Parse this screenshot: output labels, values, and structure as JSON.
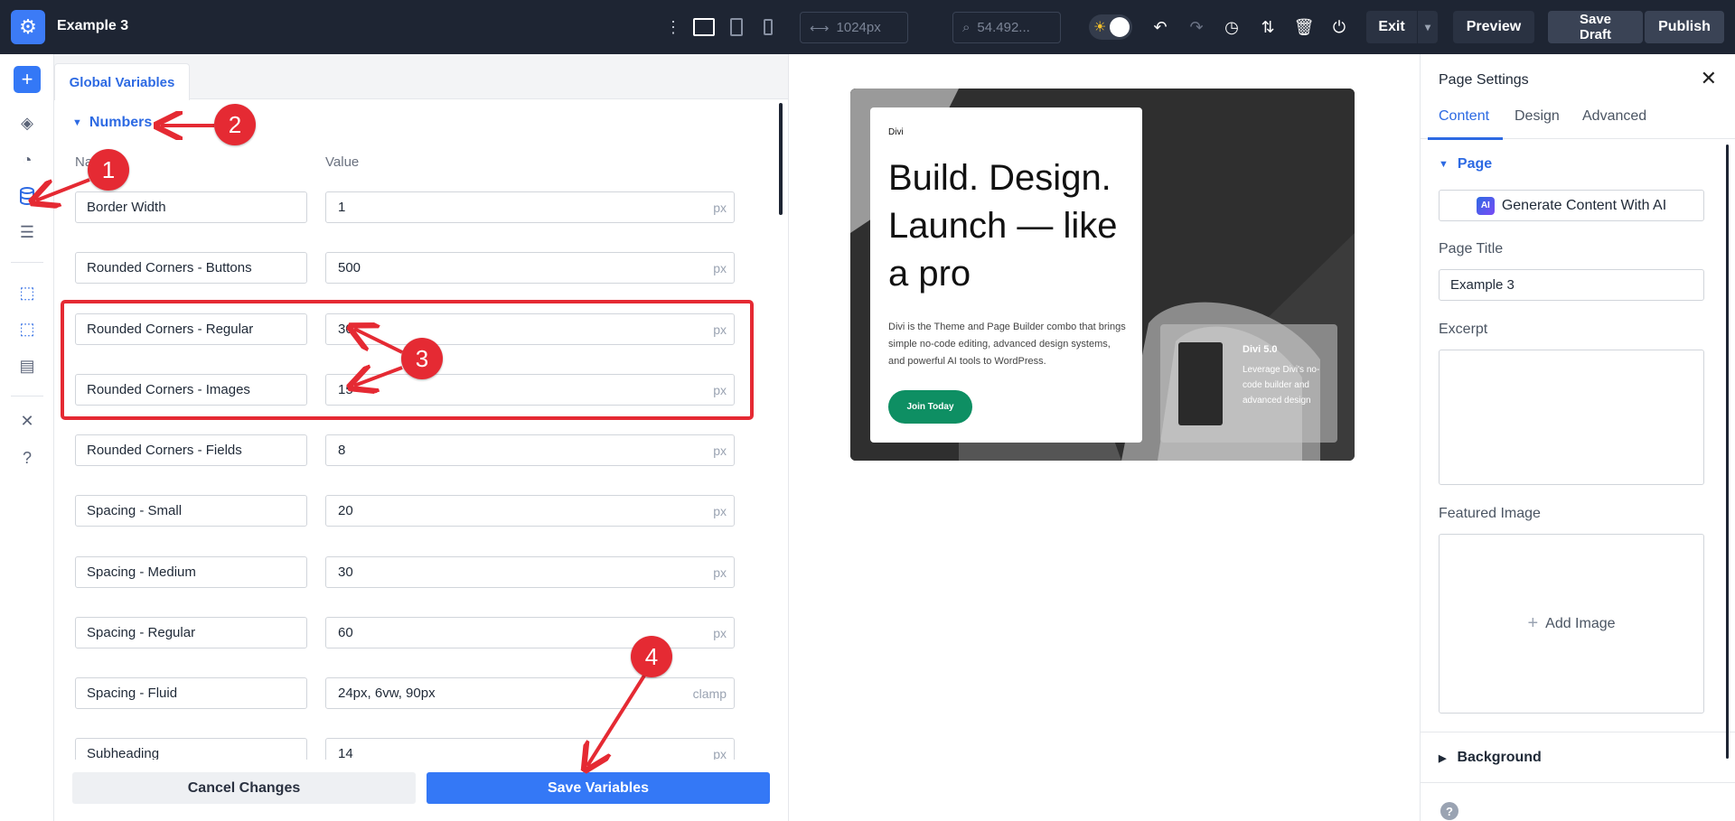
{
  "topbar": {
    "doc_title": "Example 3",
    "width_value": "1024px",
    "zoom_value": "54.492...",
    "exit_label": "Exit",
    "preview_label": "Preview",
    "save_draft_label": "Save\nDraft",
    "publish_label": "Publish"
  },
  "variables_panel": {
    "tab_label": "Global Variables",
    "section_label": "Numbers",
    "col_name": "Name",
    "col_value": "Value",
    "rows": [
      {
        "name": "Border Width",
        "value": "1",
        "unit": "px"
      },
      {
        "name": "Rounded Corners - Buttons",
        "value": "500",
        "unit": "px"
      },
      {
        "name": "Rounded Corners - Regular",
        "value": "30",
        "unit": "px"
      },
      {
        "name": "Rounded Corners - Images",
        "value": "15",
        "unit": "px"
      },
      {
        "name": "Rounded Corners - Fields",
        "value": "8",
        "unit": "px"
      },
      {
        "name": "Spacing - Small",
        "value": "20",
        "unit": "px"
      },
      {
        "name": "Spacing - Medium",
        "value": "30",
        "unit": "px"
      },
      {
        "name": "Spacing - Regular",
        "value": "60",
        "unit": "px"
      },
      {
        "name": "Spacing - Fluid",
        "value": "24px, 6vw, 90px",
        "unit": "clamp"
      },
      {
        "name": "Subheading",
        "value": "14",
        "unit": "px"
      }
    ],
    "cancel_label": "Cancel Changes",
    "save_label": "Save Variables"
  },
  "preview": {
    "brand": "Divi",
    "title": "Build. Design. Launch — like a pro",
    "text": "Divi is the Theme and Page Builder combo that brings simple no-code editing, advanced design systems, and powerful AI tools to WordPress.",
    "cta": "Join Today",
    "mini_title": "Divi 5.0",
    "mini_text": "Leverage Divi's no-code builder and advanced design"
  },
  "page_settings": {
    "title": "Page Settings",
    "tabs": [
      "Content",
      "Design",
      "Advanced"
    ],
    "active_tab": "Content",
    "section_page": "Page",
    "ai_button": "Generate Content With AI",
    "ai_badge": "AI",
    "page_title_label": "Page Title",
    "page_title_value": "Example 3",
    "excerpt_label": "Excerpt",
    "featured_image_label": "Featured Image",
    "add_image_label": "Add Image",
    "section_background": "Background"
  },
  "annotations": [
    "1",
    "2",
    "3",
    "4"
  ],
  "colors": {
    "topbar_bg": "#1e2533",
    "accent_blue": "#2d6ae3",
    "save_button": "#3478f6",
    "annotation_red": "#e52a33",
    "cta_green": "#0e8f63"
  }
}
